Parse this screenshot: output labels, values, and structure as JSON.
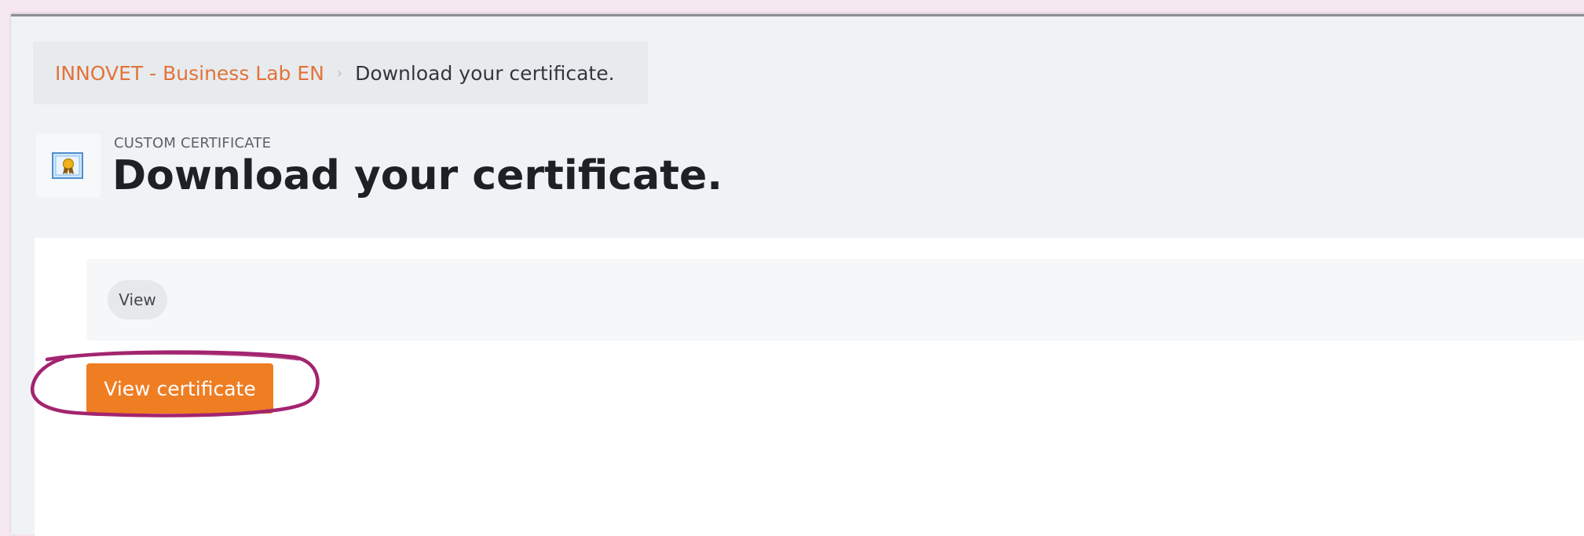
{
  "breadcrumb": {
    "course_link": "INNOVET - Business Lab EN",
    "separator": "›",
    "current": "Download your certificate."
  },
  "activity": {
    "icon": "certificate-icon",
    "type_label": "CUSTOM CERTIFICATE",
    "title": "Download your certificate."
  },
  "tabs": {
    "view_label": "View"
  },
  "actions": {
    "view_certificate_label": "View certificate"
  },
  "colors": {
    "accent": "#ef7d22",
    "link": "#e2733a",
    "highlight": "#a3246f"
  }
}
